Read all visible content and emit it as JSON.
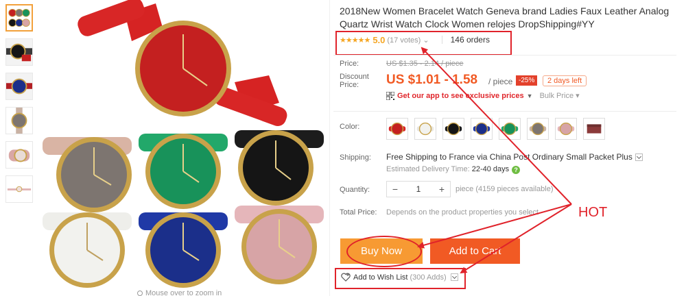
{
  "product": {
    "title": "2018New Women Bracelet Watch Geneva brand Ladies Faux Leather Analog Quartz Wrist Watch Clock Women relojes DropShipping#YY",
    "stars": "★★★★★",
    "rating": "5.0",
    "votes": "(17 votes)",
    "votes_caret": "⌄",
    "orders": "146 orders"
  },
  "price": {
    "price_label": "Price:",
    "original": "US $1.35 - 2.14 / piece",
    "discount_label": "Discount Price:",
    "discount": "US $1.01 - 1.58",
    "per_piece": "/ piece",
    "badge": "-25%",
    "days_left": "2 days left",
    "app_text": "Get our app to see exclusive prices",
    "app_caret": "▼",
    "bulk_label": "Bulk Price ▾"
  },
  "colors": {
    "label": "Color:",
    "swatches": [
      {
        "name": "red",
        "dial": "#c42020",
        "band": "#d92525"
      },
      {
        "name": "white",
        "dial": "#f2f2ee",
        "band": "#e8e6e0"
      },
      {
        "name": "black",
        "dial": "#151515",
        "band": "#1c1c1c"
      },
      {
        "name": "blue",
        "dial": "#1b2f8a",
        "band": "#2039a6"
      },
      {
        "name": "green",
        "dial": "#18925a",
        "band": "#22a86a"
      },
      {
        "name": "grey",
        "dial": "#7d7570",
        "band": "#c9b2a4"
      },
      {
        "name": "pink",
        "dial": "#d7a4a6",
        "band": "#e5b6ba"
      },
      {
        "name": "box",
        "dial": "#6d2f2f",
        "band": "#8b3a3a"
      }
    ]
  },
  "shipping": {
    "label": "Shipping:",
    "text": "Free Shipping to France via China Post Ordinary Small Packet Plus",
    "delivery_prefix": "Estimated Delivery Time:",
    "delivery_days": "22-40 days",
    "help": "?"
  },
  "quantity": {
    "label": "Quantity:",
    "minus": "−",
    "value": "1",
    "plus": "+",
    "available": "piece (4159 pieces available)"
  },
  "total": {
    "label": "Total Price:",
    "text": "Depends on the product properties you select"
  },
  "actions": {
    "buy_now": "Buy Now",
    "add_to_cart": "Add to Cart",
    "wish_label": "Add to Wish List",
    "wish_count": "(300 Adds)"
  },
  "annotation": {
    "hot": "HOT"
  },
  "gallery": {
    "zoom_hint": "Mouse over to zoom in"
  },
  "theme": {
    "accent_orange": "#f15a24",
    "buy_orange": "#f79a33",
    "annotation_red": "#e0222a",
    "star_color": "#f5a623"
  }
}
